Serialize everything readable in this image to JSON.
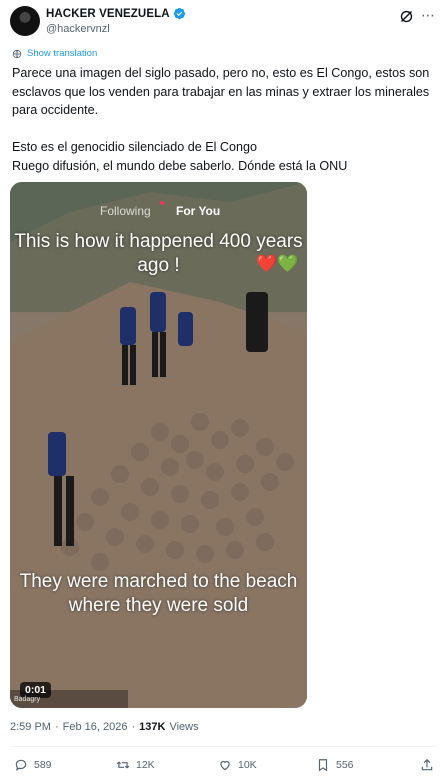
{
  "author": {
    "name": "HACKER VENEZUELA",
    "handle": "@hackervnzl"
  },
  "translation_link": "Show translation",
  "tweet": {
    "line1": "Parece una imagen del siglo pasado, pero no, esto es El Congo, estos son esclavos que los venden para trabajar en las minas y extraer los minerales para occidente.",
    "line2": "Esto es el genocidio silenciado de El Congo",
    "line3": "Ruego difusión, el mundo debe saberlo. Dónde está la ONU"
  },
  "video": {
    "tab_following": "Following",
    "tab_foryou": "For You",
    "top_caption": "This is how it happened 400 years ago !",
    "hearts": "❤️💚",
    "bottom_caption": "They were marched to the beach where they were sold",
    "duration": "0:01",
    "location_tag": "Badagry"
  },
  "meta": {
    "time": "2:59 PM",
    "sep": "·",
    "date": "Feb 16, 2026",
    "views_count": "137K",
    "views_label": "Views"
  },
  "actions": {
    "replies": "589",
    "reposts": "12K",
    "likes": "10K",
    "bookmarks": "556"
  },
  "colors": {
    "accent": "#1d9bf0",
    "muted": "#536471",
    "text": "#0f1419"
  }
}
